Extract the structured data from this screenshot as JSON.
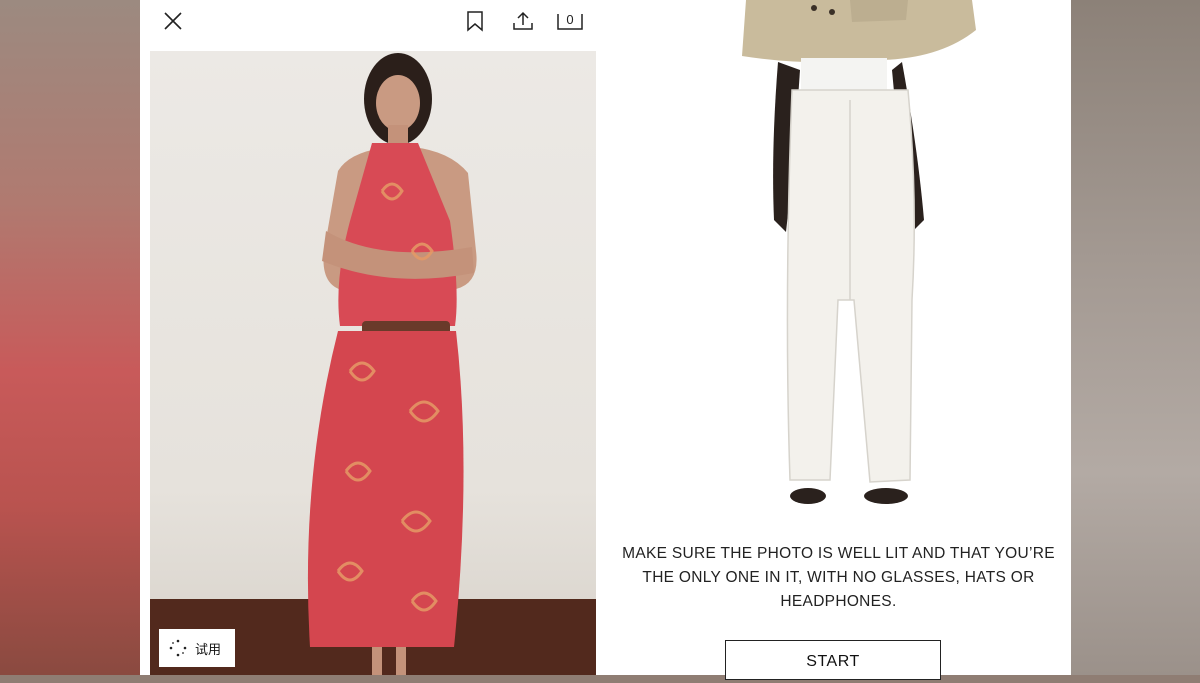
{
  "header": {
    "close_icon": "close-icon",
    "bookmark_icon": "bookmark-icon",
    "share_icon": "share-icon",
    "bag_icon": "shopping-bag-icon",
    "bag_count": "0"
  },
  "product": {
    "try_on_label": "试用",
    "try_on_icon": "sparkle-dots-icon"
  },
  "tryon_panel": {
    "instructions_line1": "MAKE SURE THE PHOTO IS WELL LIT AND THAT YOU’RE",
    "instructions_line2": "THE ONLY ONE IN IT, WITH NO GLASSES, HATS OR",
    "instructions_line3": "HEADPHONES.",
    "start_label": "START"
  },
  "colors": {
    "dress_red": "#d84a55",
    "pants_white": "#f3f1ec",
    "jacket_beige": "#c9bb9c",
    "text": "#222222"
  }
}
